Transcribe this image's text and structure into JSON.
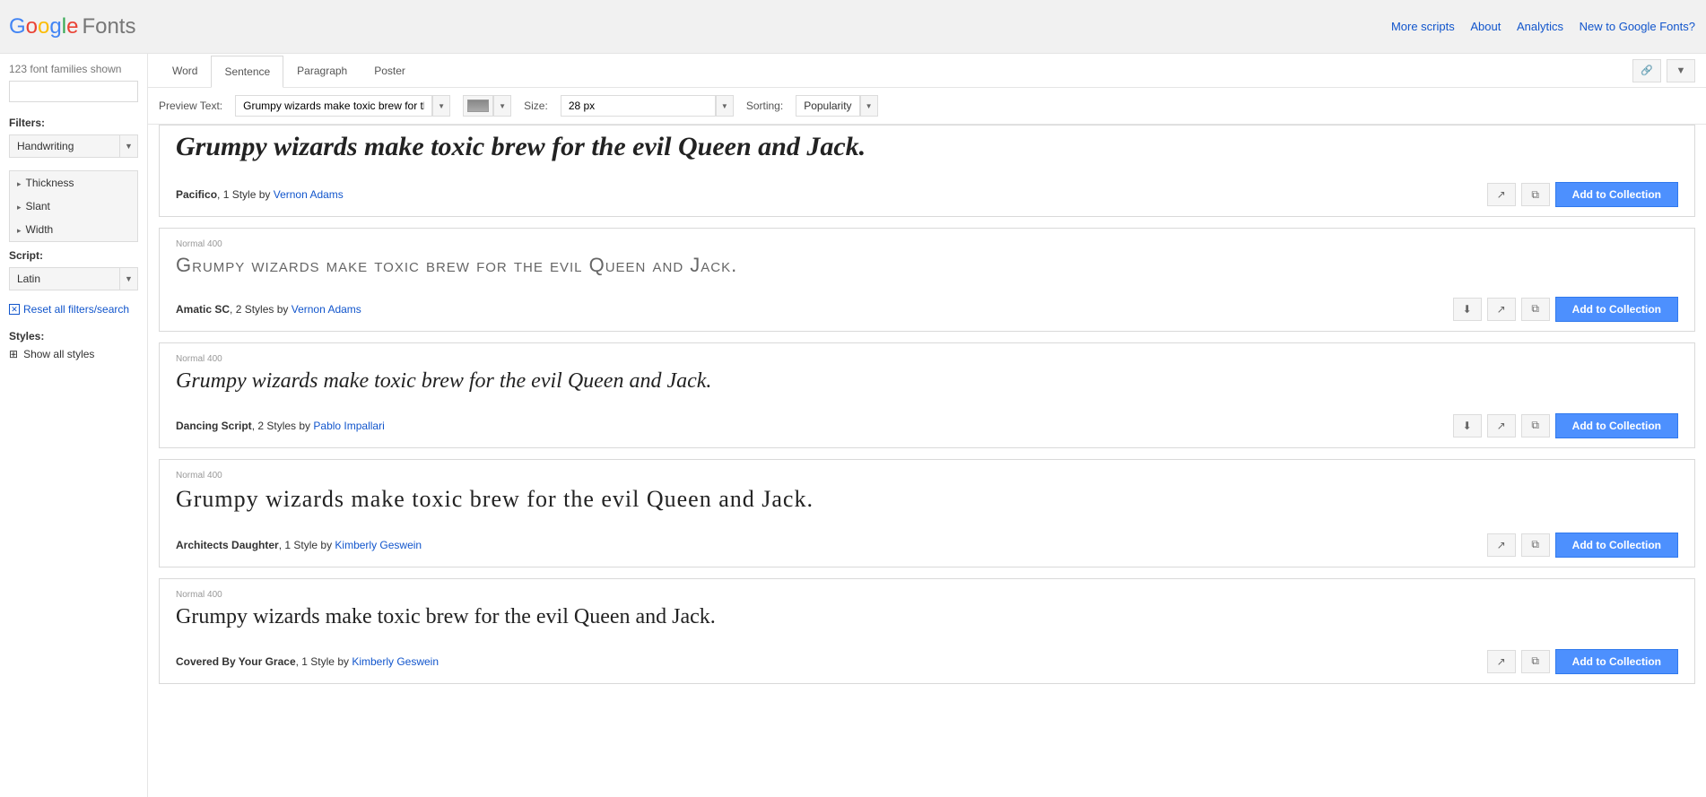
{
  "header": {
    "brand": "Fonts",
    "links": [
      "More scripts",
      "About",
      "Analytics",
      "New to Google Fonts?"
    ]
  },
  "sidebar": {
    "count": "123 font families shown",
    "filters_label": "Filters:",
    "category": "Handwriting",
    "filter_items": [
      "Thickness",
      "Slant",
      "Width"
    ],
    "script_label": "Script:",
    "script": "Latin",
    "reset": "Reset all filters/search",
    "styles_label": "Styles:",
    "show_all": "Show all styles"
  },
  "tabs": [
    "Word",
    "Sentence",
    "Paragraph",
    "Poster"
  ],
  "active_tab": "Sentence",
  "controls": {
    "preview_label": "Preview Text:",
    "preview_text": "Grumpy wizards make toxic brew for the evil",
    "size_label": "Size:",
    "size": "28 px",
    "sort_label": "Sorting:",
    "sort": "Popularity"
  },
  "add_label": "Add to Collection",
  "fonts": [
    {
      "weight": "",
      "sample": "Grumpy wizards make toxic brew for the evil Queen and Jack.",
      "sample_class": "cursive-heavy",
      "name": "Pacifico",
      "styles": ", 1 Style by ",
      "author": "Vernon Adams",
      "has_download": false
    },
    {
      "weight": "Normal 400",
      "sample": "Grumpy wizards make toxic brew for the evil Queen and Jack.",
      "sample_class": "condensed-caps",
      "name": "Amatic SC",
      "styles": ", 2 Styles by ",
      "author": "Vernon Adams",
      "has_download": true
    },
    {
      "weight": "Normal 400",
      "sample": "Grumpy wizards make toxic brew for the evil Queen and Jack.",
      "sample_class": "script-light",
      "name": "Dancing Script",
      "styles": ", 2 Styles by ",
      "author": "Pablo Impallari",
      "has_download": true
    },
    {
      "weight": "Normal 400",
      "sample": "Grumpy wizards make toxic brew for the evil Queen and Jack.",
      "sample_class": "hand-rounded",
      "name": "Architects Daughter",
      "styles": ", 1 Style by ",
      "author": "Kimberly Geswein",
      "has_download": false
    },
    {
      "weight": "Normal 400",
      "sample": "Grumpy wizards make toxic brew for the evil Queen and Jack.",
      "sample_class": "hand-narrow",
      "name": "Covered By Your Grace",
      "styles": ", 1 Style by ",
      "author": "Kimberly Geswein",
      "has_download": false
    }
  ]
}
